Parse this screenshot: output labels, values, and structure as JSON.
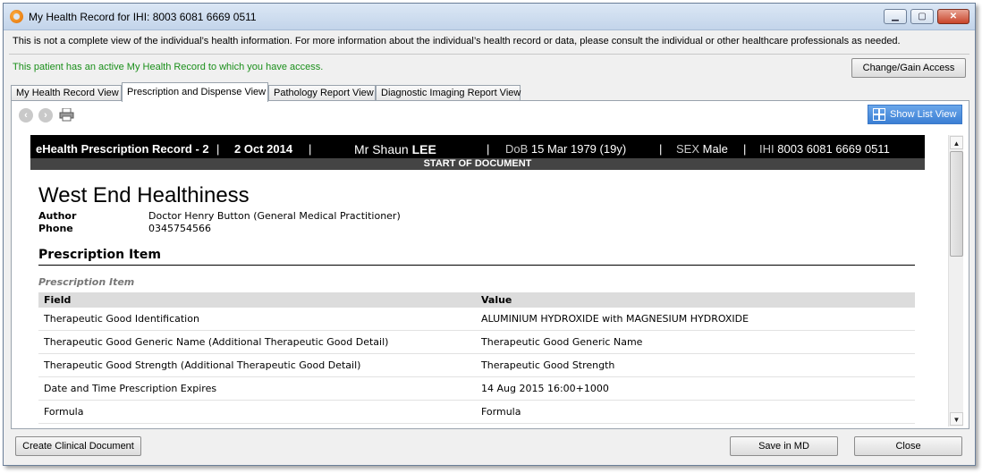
{
  "window": {
    "title": "My Health Record for IHI: 8003 6081 6669 0511",
    "controls": {
      "minimize": "▁",
      "maximize": "▢",
      "close": "✕"
    }
  },
  "disclaimer": "This is not a complete view of the individual’s health information. For more information about the individual’s health record or data, please consult the individual or other healthcare professionals as needed.",
  "access_message": "This patient has an active My Health Record to which you have access.",
  "access_color": "#1a8f1a",
  "change_access_label": "Change/Gain Access",
  "tabs": [
    {
      "label": "My Health Record View",
      "active": false
    },
    {
      "label": "Prescription and Dispense View",
      "active": true
    },
    {
      "label": "Pathology Report View",
      "active": false
    },
    {
      "label": "Diagnostic Imaging Report View",
      "active": false
    }
  ],
  "toolbar": {
    "back_icon": "back-arrow-icon",
    "forward_icon": "forward-arrow-icon",
    "print_icon": "printer-icon",
    "show_list_label": "Show List View",
    "accent": "#3b7fd4"
  },
  "document": {
    "header": {
      "record_title": "eHealth Prescription Record - 2",
      "sep1": "|",
      "date": "2 Oct 2014",
      "sep2": "|",
      "patient_prefix": "Mr Shaun",
      "patient_surname": "LEE",
      "sep3": "|",
      "dob_label": "DoB",
      "dob_value": "15 Mar 1979 (19y)",
      "sep4": "|",
      "sex_label": "SEX",
      "sex_value": "Male",
      "sep5": "|",
      "ihi_label": "IHI",
      "ihi_value": "8003 6081 6669 0511",
      "start_banner": "START OF DOCUMENT"
    },
    "organisation": "West End Healthiness",
    "author_label": "Author",
    "author_value": "Doctor Henry Button (General Medical Practitioner)",
    "phone_label": "Phone",
    "phone_value": "0345754566",
    "section_title": "Prescription Item",
    "subsection_title": "Prescription Item",
    "table": {
      "headers": [
        "Field",
        "Value"
      ],
      "rows": [
        [
          "Therapeutic Good Identification",
          "ALUMINIUM HYDROXIDE with MAGNESIUM HYDROXIDE"
        ],
        [
          "Therapeutic Good Generic Name (Additional Therapeutic Good Detail)",
          "Therapeutic Good Generic Name"
        ],
        [
          "Therapeutic Good Strength (Additional Therapeutic Good Detail)",
          "Therapeutic Good Strength"
        ],
        [
          "Date and Time Prescription Expires",
          "14 Aug 2015 16:00+1000"
        ],
        [
          "Formula",
          "Formula"
        ]
      ]
    }
  },
  "scrollbar": {
    "up": "▲",
    "down": "▼"
  },
  "footer": {
    "create_label": "Create Clinical Document",
    "save_label": "Save in MD",
    "close_label": "Close"
  }
}
